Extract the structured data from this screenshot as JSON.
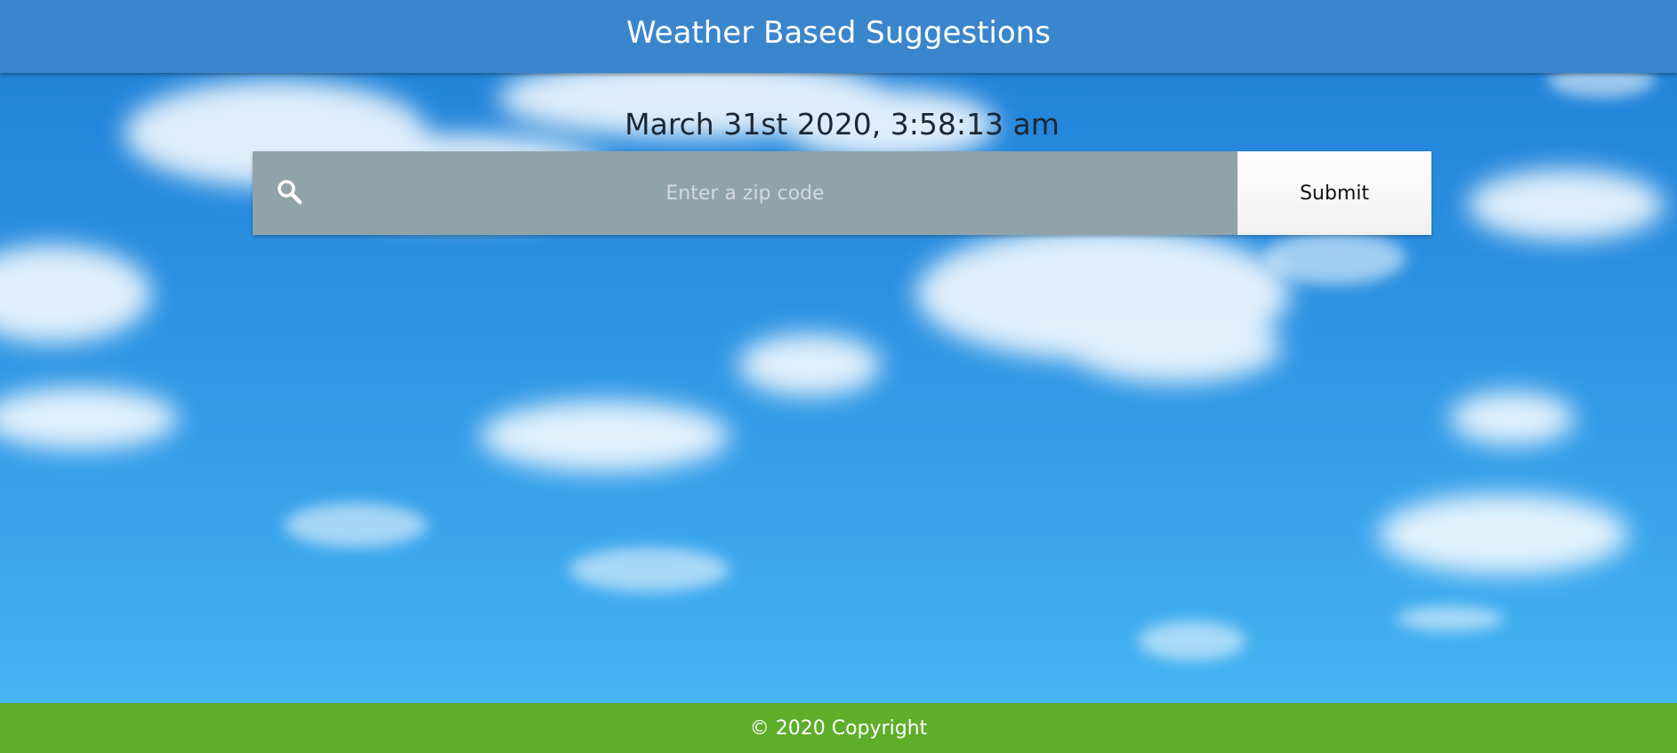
{
  "header": {
    "title": "Weather Based Suggestions"
  },
  "datetime": "March 31st 2020, 3:58:13 am",
  "search": {
    "icon": "search-icon",
    "placeholder": "Enter a zip code",
    "value": "",
    "submit_label": "Submit"
  },
  "footer": {
    "copyright": "© 2020 Copyright"
  },
  "colors": {
    "header": "#3a86cc",
    "footer": "#5fae2a",
    "search_field": "#90a3ab",
    "sky_top": "#1f7fd6",
    "sky_bottom": "#49baf3"
  }
}
